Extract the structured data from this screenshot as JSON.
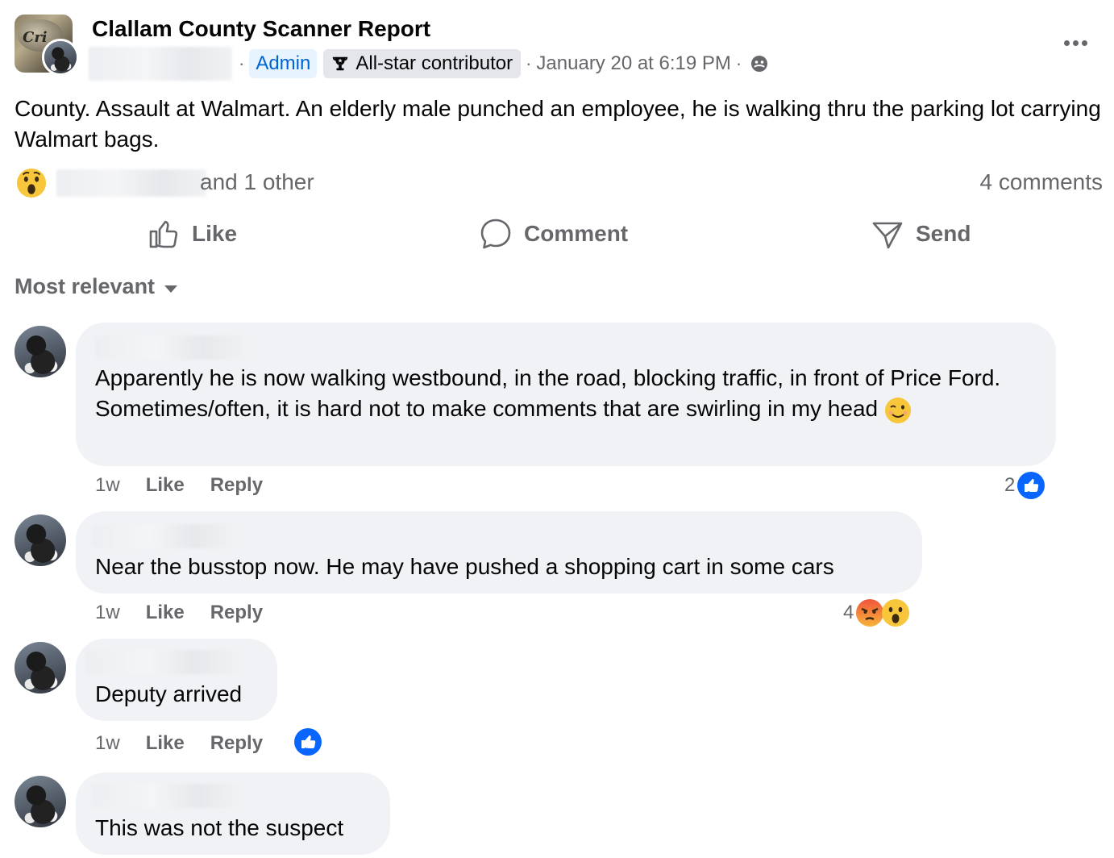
{
  "post": {
    "group_name": "Clallam County Scanner Report",
    "avatar_text": "Cri",
    "admin_badge": "Admin",
    "allstar_badge": "All-star contributor",
    "timestamp": "January 20 at 6:19 PM",
    "separator": "·",
    "body": "County. Assault at Walmart. An elderly male punched an employee, he is walking thru the parking lot carrying Walmart bags.",
    "reactions_text": "and 1 other",
    "comments_count": "4 comments"
  },
  "actions": {
    "like": "Like",
    "comment": "Comment",
    "send": "Send"
  },
  "sort": {
    "label": "Most relevant"
  },
  "comments": [
    {
      "text": "Apparently he is now walking westbound, in the road, blocking traffic, in front of Price Ford. Sometimes/often, it is hard not to make comments that are swirling in my head",
      "time": "1w",
      "like": "Like",
      "reply": "Reply",
      "reaction_count": "2",
      "reactions": [
        "like-icon"
      ]
    },
    {
      "text": "Near the busstop now. He may have pushed a shopping cart in some cars",
      "time": "1w",
      "like": "Like",
      "reply": "Reply",
      "reaction_count": "4",
      "reactions": [
        "angry-icon",
        "wow-icon"
      ]
    },
    {
      "text": "Deputy arrived",
      "time": "1w",
      "like": "Like",
      "reply": "Reply",
      "reaction_count": "",
      "reactions": [
        "like-icon"
      ]
    },
    {
      "text": "This was not the suspect",
      "time": "",
      "like": "",
      "reply": "",
      "reaction_count": "",
      "reactions": []
    }
  ],
  "colors": {
    "blue": "#0866ff",
    "meta_gray": "#65676b",
    "bubble": "#f0f2f5",
    "admin_bg": "#e7f3ff",
    "admin_text": "#0064d1"
  }
}
